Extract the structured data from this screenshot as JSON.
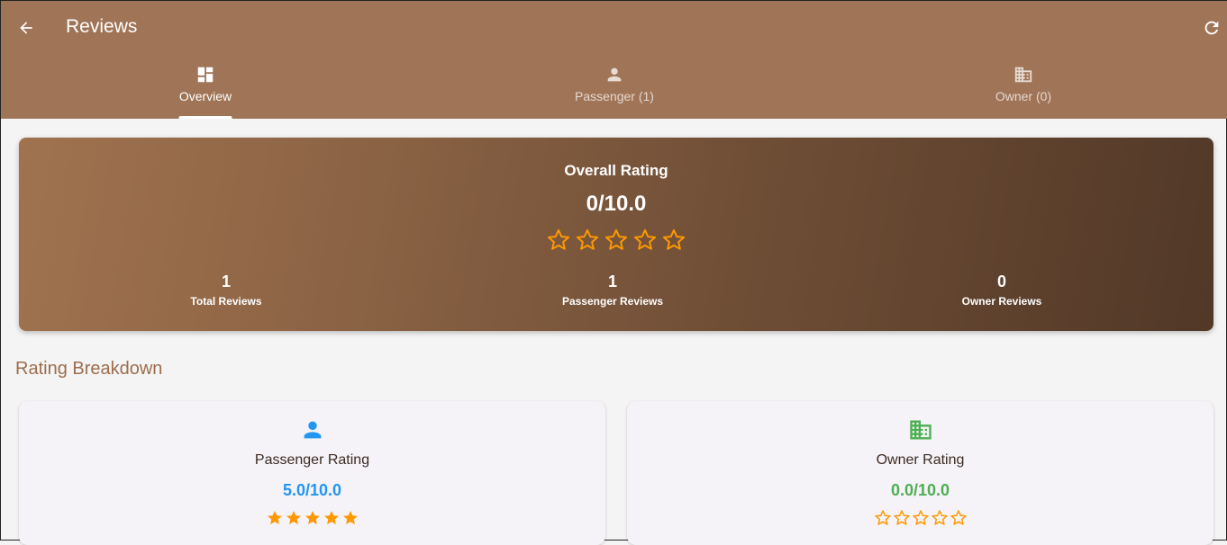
{
  "appbar": {
    "title": "Reviews",
    "back_icon": "arrow-left-icon",
    "refresh_icon": "refresh-icon"
  },
  "tabs": [
    {
      "label": "Overview",
      "icon": "dashboard-icon",
      "active": true
    },
    {
      "label": "Passenger (1)",
      "icon": "person-icon",
      "active": false
    },
    {
      "label": "Owner (0)",
      "icon": "business-icon",
      "active": false
    }
  ],
  "overall": {
    "title": "Overall Rating",
    "score": "0/10.0",
    "stars_filled": 0,
    "stars_total": 5,
    "stats": [
      {
        "value": "1",
        "label": "Total Reviews"
      },
      {
        "value": "1",
        "label": "Passenger Reviews"
      },
      {
        "value": "0",
        "label": "Owner Reviews"
      }
    ]
  },
  "breakdown": {
    "title": "Rating Breakdown",
    "cards": [
      {
        "title": "Passenger Rating",
        "score": "5.0/10.0",
        "icon": "person-icon",
        "color": "#2196f3",
        "stars_filled": 5,
        "stars_total": 5
      },
      {
        "title": "Owner Rating",
        "score": "0.0/10.0",
        "icon": "business-icon",
        "color": "#4caf50",
        "stars_filled": 0,
        "stars_total": 5
      }
    ]
  },
  "colors": {
    "appbar": "#a07456",
    "star": "#ff9800",
    "section_title": "#9d6d4d"
  }
}
